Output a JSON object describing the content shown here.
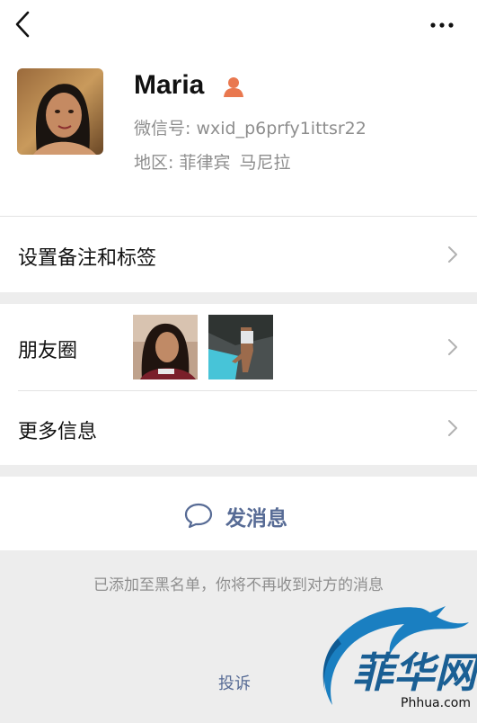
{
  "header": {
    "back_icon": "chevron-left-icon",
    "more_icon": "ellipsis-icon"
  },
  "profile": {
    "name": "Maria",
    "gender_icon": "person-icon",
    "gender_color": "#e9784f",
    "wechat_id_label": "微信号: ",
    "wechat_id_value": "wxid_p6prfy1ittsr22",
    "region_label": "地区: ",
    "region_country": "菲律宾",
    "region_city": "马尼拉"
  },
  "menu": {
    "remark_tags": "设置备注和标签",
    "moments": "朋友圈",
    "more_info": "更多信息"
  },
  "actions": {
    "send_message": "发消息",
    "send_icon": "chat-bubble-icon",
    "accent_color": "#576b95"
  },
  "footer": {
    "blocked_notice": "已添加至黑名单，你将不再收到对方的消息",
    "report": "投诉"
  },
  "watermark": {
    "chars": "菲华网",
    "site": "Phhua.com"
  }
}
